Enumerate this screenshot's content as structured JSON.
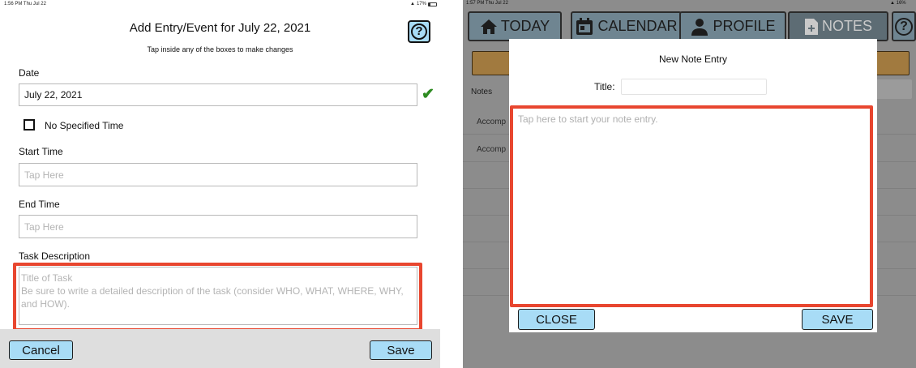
{
  "left": {
    "status": {
      "time": "1:56 PM  Thu Jul 22",
      "battery": "17%"
    },
    "title": "Add Entry/Event for July 22, 2021",
    "subtitle": "Tap inside any of the boxes to make changes",
    "help_label": "?",
    "date": {
      "label": "Date",
      "value": "July 22, 2021",
      "confirm_mark": "✔"
    },
    "no_time": {
      "label": "No Specified Time",
      "checked": false
    },
    "start_time": {
      "label": "Start Time",
      "placeholder": "Tap Here"
    },
    "end_time": {
      "label": "End Time",
      "placeholder": "Tap Here"
    },
    "task": {
      "label": "Task Description",
      "placeholder_title": "Title of Task",
      "placeholder_body": "Be sure to write a detailed description of the task (consider WHO, WHAT, WHERE, WHY, and HOW)."
    },
    "cancel_label": "Cancel",
    "save_label": "Save"
  },
  "right": {
    "status": {
      "time": "1:57 PM  Thu Jul 22",
      "battery": "16%"
    },
    "tabs": [
      {
        "label": "TODAY",
        "icon": "home-icon"
      },
      {
        "label": "CALENDAR",
        "icon": "calendar-icon"
      },
      {
        "label": "PROFILE",
        "icon": "person-icon"
      },
      {
        "label": "NOTES",
        "icon": "note-add-icon"
      }
    ],
    "help_label": "?",
    "background": {
      "notes_label": "Notes",
      "items": [
        "Accomp",
        "Accomp"
      ]
    },
    "modal": {
      "title": "New Note Entry",
      "title_field_label": "Title:",
      "title_field_value": "",
      "body_placeholder": "Tap here to start your note entry.",
      "close_label": "CLOSE",
      "save_label": "SAVE"
    }
  },
  "colors": {
    "button_fill": "#a8dcf6",
    "highlight_border": "#e8462f",
    "check_green": "#2e8b22",
    "tab_fill": "#6f8591",
    "banner_fill": "#a17a3f"
  }
}
